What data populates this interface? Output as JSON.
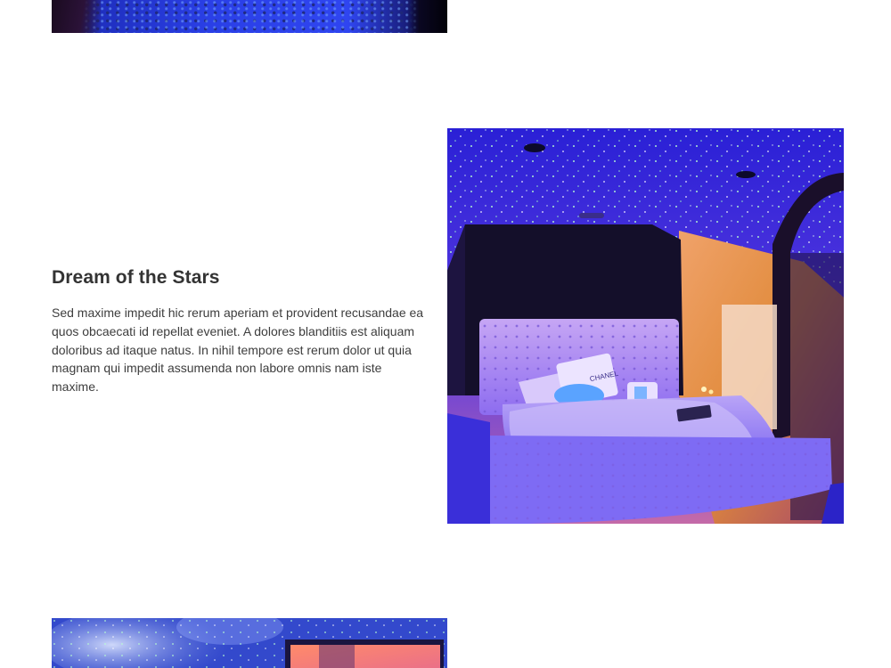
{
  "feature": {
    "title": "Dream of the Stars",
    "body": "Sed maxime impedit hic rerum aperiam et provident recusandae ea quos obcaecati id repellat eveniet. A dolores blanditiis est aliquam doloribus ad itaque natus. In nihil tempore est rerum dolor ut quia magnam qui impedit assumenda non labore omnis nam iste maxime."
  },
  "pillow_text": "CHANEL",
  "colors": {
    "background": "#ffffff",
    "heading": "#333333",
    "body_text": "#3d3d3d",
    "starlight_blue": "#2b23c8",
    "warm_glow": "#e08a3a"
  }
}
